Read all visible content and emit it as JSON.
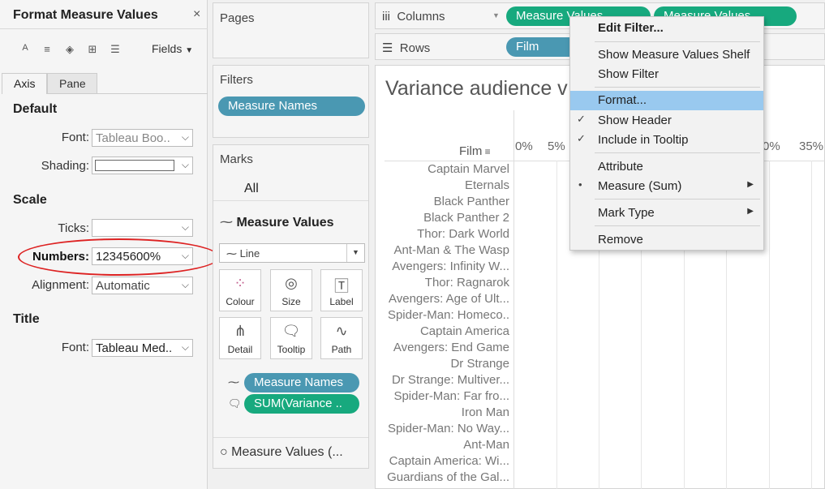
{
  "format_panel": {
    "title": "Format Measure Values",
    "close": "×",
    "fields_label": "Fields",
    "tabs": [
      "Axis",
      "Pane"
    ],
    "default_section": "Default",
    "font_label": "Font:",
    "font_value": "Tableau Boo..",
    "shading_label": "Shading:",
    "scale_section": "Scale",
    "ticks_label": "Ticks:",
    "ticks_value": "",
    "numbers_label": "Numbers:",
    "numbers_value": "12345600%",
    "alignment_label": "Alignment:",
    "alignment_value": "Automatic",
    "title_section": "Title",
    "title_font_label": "Font:",
    "title_font_value": "Tableau Med.."
  },
  "pages": {
    "title": "Pages"
  },
  "filters": {
    "title": "Filters",
    "pill": "Measure Names"
  },
  "marks": {
    "title": "Marks",
    "all": "All",
    "measure_values": "Measure Values",
    "mark_type": "Line",
    "buttons": [
      "Colour",
      "Size",
      "Label",
      "Detail",
      "Tooltip",
      "Path"
    ],
    "pill_measure_names": "Measure Names",
    "pill_sum": "SUM(Variance ..",
    "footer": "Measure Values (..."
  },
  "shelves": {
    "columns_label": "Columns",
    "columns_pill_1": "Measure Values",
    "columns_pill_2": "Measure Values",
    "rows_label": "Rows",
    "rows_pill": "Film"
  },
  "view": {
    "title": "Variance audience v",
    "film_header": "Film",
    "axis_labels": [
      "0%",
      "5%",
      "0%",
      "35%"
    ],
    "films": [
      "Captain Marvel",
      "Eternals",
      "Black Panther",
      "Black Panther 2",
      "Thor: Dark World",
      "Ant-Man & The Wasp",
      "Avengers: Infinity W...",
      "Thor: Ragnarok",
      "Avengers: Age of Ult...",
      "Spider-Man: Homeco..",
      "Captain America",
      "Avengers: End Game",
      "Dr Strange",
      "Dr Strange: Multiver...",
      "Spider-Man: Far fro...",
      "Iron Man",
      "Spider-Man: No Way...",
      "Ant-Man",
      "Captain America: Wi...",
      "Guardians of the Gal..."
    ]
  },
  "context_menu": {
    "edit_filter": "Edit Filter...",
    "show_shelf": "Show Measure Values Shelf",
    "show_filter": "Show Filter",
    "format": "Format...",
    "show_header": "Show Header",
    "include_tooltip": "Include in Tooltip",
    "attribute": "Attribute",
    "measure_sum": "Measure (Sum)",
    "mark_type": "Mark Type",
    "remove": "Remove"
  },
  "colors": {
    "blue_pill": "#4a98b2",
    "green_pill": "#17a97e",
    "menu_highlight": "#99c9ef",
    "annotation": "#dd2222"
  }
}
